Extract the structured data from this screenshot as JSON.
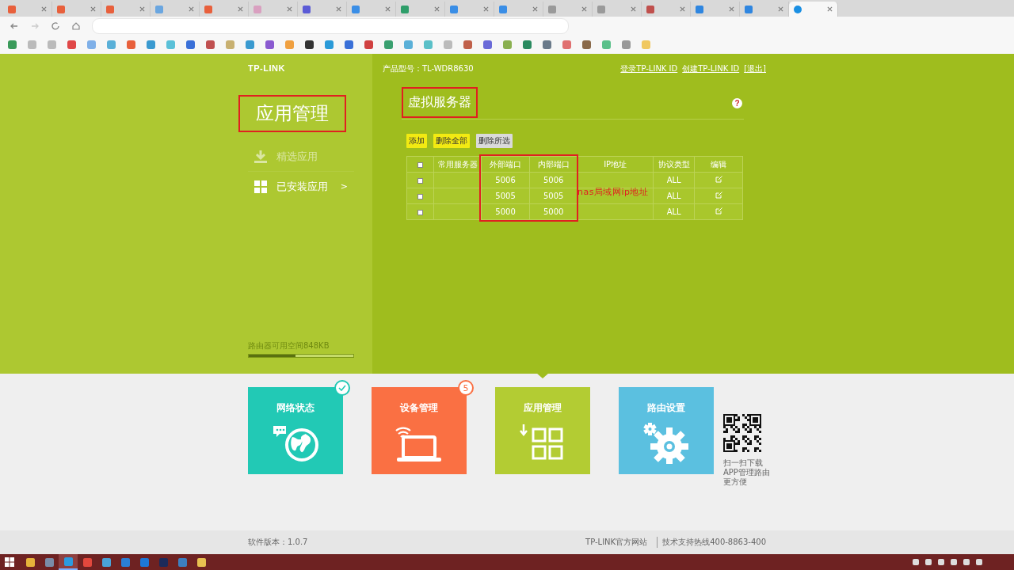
{
  "browser": {
    "tabs": [
      {
        "color": "#e8603c",
        "selected": false
      },
      {
        "color": "#e8603c",
        "selected": false
      },
      {
        "color": "#e8603c",
        "selected": false
      },
      {
        "color": "#6aa6e0",
        "selected": false
      },
      {
        "color": "#e8603c",
        "selected": false
      },
      {
        "color": "#d9a0c0",
        "selected": false
      },
      {
        "color": "#5b5bd6",
        "selected": false
      },
      {
        "color": "#3a8ee6",
        "selected": false
      },
      {
        "color": "#2f9e6a",
        "selected": false
      },
      {
        "color": "#3a8ee6",
        "selected": false
      },
      {
        "color": "#3a8ee6",
        "selected": false
      },
      {
        "color": "#9a9a9a",
        "selected": false
      },
      {
        "color": "#9a9a9a",
        "selected": false
      },
      {
        "color": "#c0504d",
        "selected": false
      },
      {
        "color": "#2f86e0",
        "selected": false
      },
      {
        "color": "#2f86e0",
        "selected": false
      },
      {
        "color": "#1a8fe3",
        "selected": true
      }
    ]
  },
  "router": {
    "logo": "TP-LINK",
    "model_label": "产品型号：TL-WDR8630",
    "header_links": [
      "登录TP-LINK ID",
      "创建TP-LINK ID",
      "[退出]"
    ],
    "section_title": {
      "text": "应用管理",
      "annotated": true
    },
    "nav": [
      {
        "kind": "download",
        "label": "精选应用",
        "selected": false
      },
      {
        "kind": "grid",
        "label": "已安装应用",
        "selected": true,
        "arrow": ">"
      }
    ],
    "storage": {
      "label": "路由器可用空间848KB",
      "level": 0.45
    },
    "panel_title": {
      "text": "虚拟服务器",
      "annotated": true
    },
    "help": "?",
    "actions": [
      {
        "label": "添加",
        "disabled": false
      },
      {
        "label": "删除全部",
        "disabled": false
      },
      {
        "label": "删除所选",
        "disabled": true
      }
    ],
    "table": {
      "select_all_checked": false,
      "columns": [
        {
          "label": "常用服务器",
          "annotated": false
        },
        {
          "label": "外部端口",
          "annotated": true
        },
        {
          "label": "内部端口",
          "annotated": true
        },
        {
          "label": "IP地址",
          "annotated": false
        },
        {
          "label": "协议类型",
          "annotated": false
        },
        {
          "label": "编辑",
          "annotated": false
        }
      ],
      "rows": [
        {
          "checked": false,
          "external": "5006",
          "internal": "5006",
          "protocol": "ALL"
        },
        {
          "checked": false,
          "external": "5005",
          "internal": "5005",
          "protocol": "ALL"
        },
        {
          "checked": false,
          "external": "5000",
          "internal": "5000",
          "protocol": "ALL"
        }
      ]
    },
    "annotation": "nas局域网ip地址",
    "tiles": [
      {
        "kind": "globe",
        "label": "网络状态",
        "color": "#22c9b5",
        "selected": false,
        "badge": {
          "kind": "check"
        }
      },
      {
        "kind": "laptop",
        "label": "设备管理",
        "color": "#fa7043",
        "selected": false,
        "badge": {
          "kind": "count",
          "text": "5"
        }
      },
      {
        "kind": "apps",
        "label": "应用管理",
        "color": "#b3cc33",
        "selected": true
      },
      {
        "kind": "gears",
        "label": "路由设置",
        "color": "#5bc0e0",
        "selected": false
      }
    ],
    "qr_caption": [
      "扫一扫下载",
      "APP管理路由",
      "更方便"
    ],
    "footer": {
      "version": "软件版本：1.0.7",
      "links": [
        "TP-LINK官方网站",
        "技术支持热线400-8863-400"
      ]
    }
  },
  "taskbar": {
    "apps": [
      {
        "color": "#e6b33a",
        "selected": false
      },
      {
        "color": "#7a8ca8",
        "selected": false
      },
      {
        "color": "#2c9be0",
        "selected": true
      },
      {
        "color": "#e2483d",
        "selected": false
      },
      {
        "color": "#4aa3d8",
        "selected": false
      },
      {
        "color": "#2b7fd4",
        "selected": false
      },
      {
        "color": "#1e78d6",
        "selected": false
      },
      {
        "color": "#1c2a5a",
        "selected": false
      },
      {
        "color": "#3d7fc0",
        "selected": false
      },
      {
        "color": "#e8c050",
        "selected": false
      }
    ]
  }
}
